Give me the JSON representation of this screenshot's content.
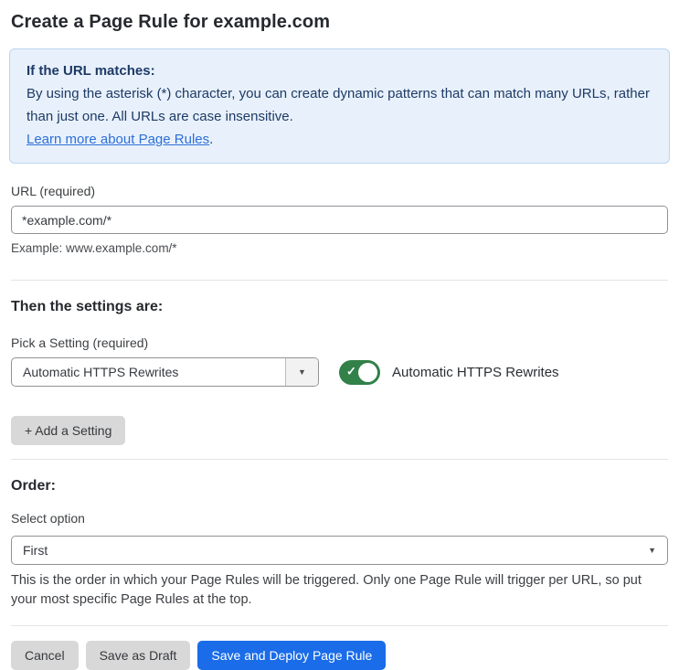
{
  "page": {
    "title": "Create a Page Rule for example.com"
  },
  "info_box": {
    "heading": "If the URL matches:",
    "body": "By using the asterisk (*) character, you can create dynamic patterns that can match many URLs, rather than just one. All URLs are case insensitive.",
    "link_text": "Learn more about Page Rules",
    "link_suffix": "."
  },
  "url_field": {
    "label": "URL (required)",
    "value": "*example.com/*",
    "helper": "Example: www.example.com/*"
  },
  "settings_section": {
    "heading": "Then the settings are:",
    "picker_label": "Pick a Setting (required)",
    "picker_value": "Automatic HTTPS Rewrites",
    "picker_caret": "▼",
    "toggle_state": "on",
    "toggle_check": "✓",
    "toggle_label": "Automatic HTTPS Rewrites",
    "add_button_label": "+ Add a Setting"
  },
  "order_section": {
    "heading": "Order:",
    "select_label": "Select option",
    "select_value": "First",
    "select_caret": "▼",
    "helper": "This is the order in which your Page Rules will be triggered. Only one Page Rule will trigger per URL, so put your most specific Page Rules at the top."
  },
  "footer": {
    "cancel_label": "Cancel",
    "save_draft_label": "Save as Draft",
    "save_deploy_label": "Save and Deploy Page Rule"
  },
  "colors": {
    "info_bg": "#e8f1fb",
    "info_border": "#bad5ef",
    "info_text": "#1e3a66",
    "link_blue": "#2d6fd9",
    "toggle_green": "#318149",
    "primary_blue": "#1a6ce8",
    "button_gray": "#d8d8d8"
  }
}
